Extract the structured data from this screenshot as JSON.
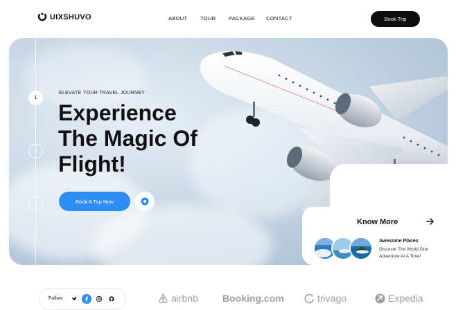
{
  "header": {
    "logo_text": "UIXSHUVO",
    "nav": [
      "ABOUT",
      "TOUR",
      "PACKAGE",
      "CONTACT"
    ],
    "cta_label": "Book Trip"
  },
  "hero": {
    "steps": [
      "1",
      "2",
      "3"
    ],
    "active_step": "1",
    "eyebrow": "ELEVATE YOUR TRAVEL JOURNEY",
    "headline_lines": [
      "Experience",
      "The Magic Of",
      "Flight!"
    ],
    "cta_label": "Book A Trip Now"
  },
  "know_more": {
    "title": "Know More",
    "item_title": "Awesome Places",
    "item_desc": "Discover The World One Adventure At A Time!"
  },
  "footer": {
    "follow_label": "Follow",
    "social_icons": [
      "twitter-icon",
      "facebook-icon",
      "instagram-icon",
      "github-icon"
    ],
    "brands": [
      "airbnb",
      "Booking.com",
      "trivago",
      "Expedia"
    ]
  },
  "colors": {
    "accent": "#2f8cf2",
    "dark": "#0d0d0d",
    "brand_gray": "#9aa0a8"
  }
}
